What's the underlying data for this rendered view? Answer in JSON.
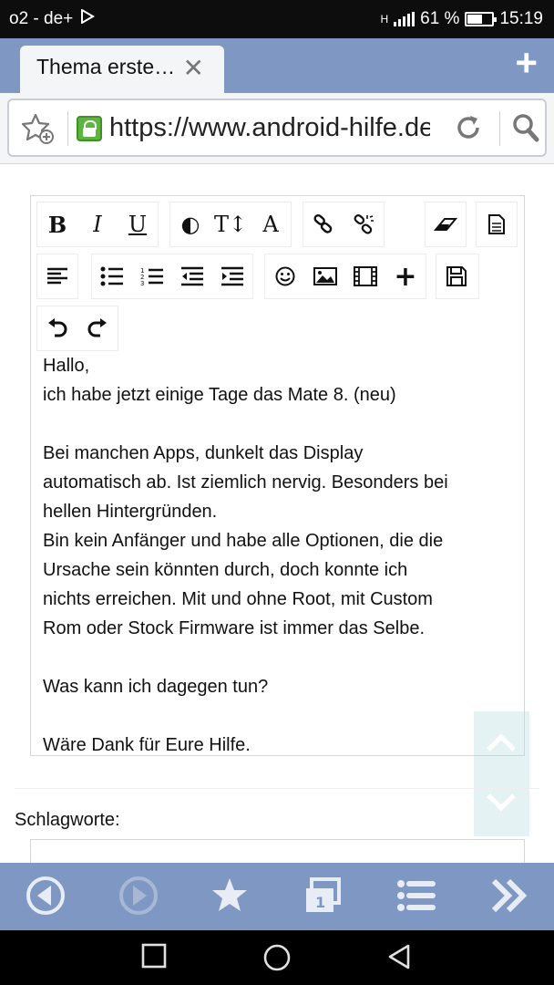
{
  "status_bar": {
    "carrier": "o2 - de+",
    "network": "H",
    "battery_percent_text": "61 %",
    "battery_level": 0.61,
    "time": "15:19"
  },
  "tab": {
    "title": "Thema erste…",
    "close_icon": "close-icon",
    "new_tab_icon": "plus-icon"
  },
  "url_bar": {
    "url": "https://www.android-hilfe.de/forum/",
    "secure": true
  },
  "editor": {
    "toolbar_row1": [
      {
        "name": "bold-button",
        "label": "B"
      },
      {
        "name": "italic-button",
        "label": "I"
      },
      {
        "name": "underline-button",
        "label": "U"
      },
      {
        "name": "text-color-icon",
        "label": "◐"
      },
      {
        "name": "font-size-icon",
        "label": "T↕"
      },
      {
        "name": "font-icon",
        "label": "A"
      },
      {
        "name": "link-icon",
        "label": ""
      },
      {
        "name": "unlink-icon",
        "label": ""
      },
      {
        "name": "eraser-icon",
        "label": ""
      },
      {
        "name": "source-icon",
        "label": ""
      }
    ],
    "toolbar_row2": [
      "align-left-icon",
      "bullet-list-icon",
      "numbered-list-icon",
      "outdent-icon",
      "indent-icon",
      "smiley-icon",
      "image-icon",
      "video-icon",
      "plus-icon",
      "save-icon"
    ],
    "toolbar_row3": [
      "undo-icon",
      "redo-icon"
    ],
    "lines": [
      "Hallo,",
      "ich habe jetzt einige Tage das Mate 8. (neu)",
      "",
      "Bei manchen Apps, dunkelt das Display",
      "automatisch ab. Ist ziemlich nervig. Besonders bei",
      "hellen Hintergründen.",
      "Bin kein Anfänger und habe alle Optionen, die die",
      "Ursache sein könnten durch, doch konnte ich",
      "nichts erreichen. Mit und ohne Root, mit Custom",
      "Rom oder Stock Firmware ist immer das Selbe.",
      "",
      "Was kann ich dagegen tun?",
      "",
      "Wäre Dank für Eure Hilfe."
    ]
  },
  "tags": {
    "label": "Schlagworte:",
    "value": ""
  },
  "colors": {
    "browser_chrome": "#7e98c3",
    "status_bar": "#0d0d0d",
    "lock_green": "#5db43f"
  }
}
